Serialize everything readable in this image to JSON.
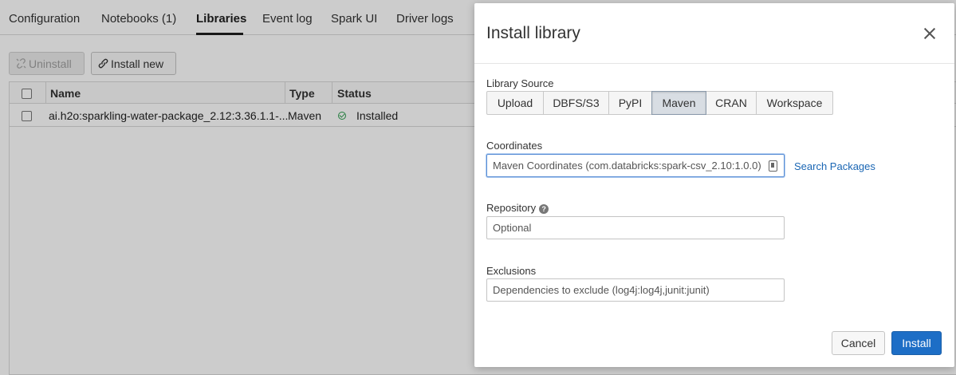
{
  "tabs": [
    {
      "label": "Configuration"
    },
    {
      "label": "Notebooks (1)"
    },
    {
      "label": "Libraries"
    },
    {
      "label": "Event log"
    },
    {
      "label": "Spark UI"
    },
    {
      "label": "Driver logs"
    }
  ],
  "active_tab": "Libraries",
  "toolbar": {
    "uninstall_label": "Uninstall",
    "install_new_label": "Install new"
  },
  "table": {
    "columns": [
      "Name",
      "Type",
      "Status"
    ],
    "rows": [
      {
        "name": "ai.h2o:sparkling-water-package_2.12:3.36.1.1-...",
        "type": "Maven",
        "status": "Installed"
      }
    ]
  },
  "modal": {
    "title": "Install library",
    "library_source_label": "Library Source",
    "sources": [
      "Upload",
      "DBFS/S3",
      "PyPI",
      "Maven",
      "CRAN",
      "Workspace"
    ],
    "selected_source": "Maven",
    "coordinates_label": "Coordinates",
    "coordinates_placeholder": "Maven Coordinates (com.databricks:spark-csv_2.10:1.0.0)",
    "search_packages_label": "Search Packages",
    "repository_label": "Repository",
    "repository_placeholder": "Optional",
    "exclusions_label": "Exclusions",
    "exclusions_placeholder": "Dependencies to exclude (log4j:log4j,junit:junit)",
    "cancel_label": "Cancel",
    "install_label": "Install"
  },
  "colors": {
    "primary": "#1d6ec6",
    "link": "#1a66b4",
    "success": "#2e9e4f"
  }
}
